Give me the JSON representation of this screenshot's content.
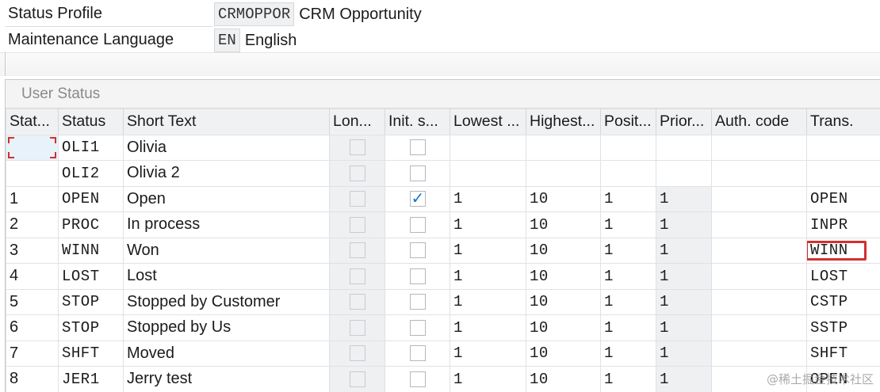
{
  "header": {
    "status_profile": {
      "label": "Status Profile",
      "value": "CRMOPPOR",
      "description": "CRM Opportunity"
    },
    "maintenance_language": {
      "label": "Maintenance Language",
      "value": "EN",
      "description": "English"
    }
  },
  "user_status": {
    "title": "User Status",
    "columns": [
      "Stat...",
      "Status",
      "Short Text",
      "Lon...",
      "Init. s...",
      "Lowest ...",
      "Highest...",
      "Posit...",
      "Prior...",
      "Auth. code",
      "Trans."
    ],
    "rows": [
      {
        "stat": "",
        "status": "OLI1",
        "short_text": "Olivia",
        "long_text": false,
        "init_status": false,
        "lowest": "",
        "highest": "",
        "position": "",
        "priority": "",
        "auth_code": "",
        "trans": ""
      },
      {
        "stat": "",
        "status": "OLI2",
        "short_text": "Olivia 2",
        "long_text": false,
        "init_status": false,
        "lowest": "",
        "highest": "",
        "position": "",
        "priority": "",
        "auth_code": "",
        "trans": ""
      },
      {
        "stat": "1",
        "status": "OPEN",
        "short_text": "Open",
        "long_text": false,
        "init_status": true,
        "lowest": "1",
        "highest": "10",
        "position": "1",
        "priority": "1",
        "auth_code": "",
        "trans": "OPEN"
      },
      {
        "stat": "2",
        "status": "PROC",
        "short_text": "In process",
        "long_text": false,
        "init_status": false,
        "lowest": "1",
        "highest": "10",
        "position": "1",
        "priority": "1",
        "auth_code": "",
        "trans": "INPR"
      },
      {
        "stat": "3",
        "status": "WINN",
        "short_text": "Won",
        "long_text": false,
        "init_status": false,
        "lowest": "1",
        "highest": "10",
        "position": "1",
        "priority": "1",
        "auth_code": "",
        "trans": "WINN"
      },
      {
        "stat": "4",
        "status": "LOST",
        "short_text": "Lost",
        "long_text": false,
        "init_status": false,
        "lowest": "1",
        "highest": "10",
        "position": "1",
        "priority": "1",
        "auth_code": "",
        "trans": "LOST"
      },
      {
        "stat": "5",
        "status": "STOP",
        "short_text": "Stopped by Customer",
        "long_text": false,
        "init_status": false,
        "lowest": "1",
        "highest": "10",
        "position": "1",
        "priority": "1",
        "auth_code": "",
        "trans": "CSTP"
      },
      {
        "stat": "6",
        "status": "STOP",
        "short_text": "Stopped by Us",
        "long_text": false,
        "init_status": false,
        "lowest": "1",
        "highest": "10",
        "position": "1",
        "priority": "1",
        "auth_code": "",
        "trans": "SSTP"
      },
      {
        "stat": "7",
        "status": "SHFT",
        "short_text": "Moved",
        "long_text": false,
        "init_status": false,
        "lowest": "1",
        "highest": "10",
        "position": "1",
        "priority": "1",
        "auth_code": "",
        "trans": "SHFT"
      },
      {
        "stat": "8",
        "status": "JER1",
        "short_text": "Jerry test",
        "long_text": false,
        "init_status": false,
        "lowest": "1",
        "highest": "10",
        "position": "1",
        "priority": "1",
        "auth_code": "",
        "trans": "OPEN"
      }
    ]
  },
  "watermark": "@稀土掘金技术社区",
  "colors": {
    "highlight": "#d32f2f",
    "check": "#1a73c9",
    "header_bg": "#f0f1f2"
  }
}
